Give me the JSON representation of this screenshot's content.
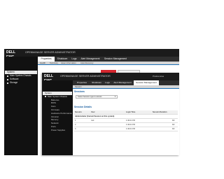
{
  "back_window": {
    "brand": "DELL EMC",
    "app_title": "OPENMANAGE SERVER ADMINISTRATOR",
    "host_info": "",
    "tree": [
      {
        "label": "System",
        "selected": true
      },
      {
        "label": "Main System Chassis",
        "selected": false
      },
      {
        "label": "Software",
        "selected": false
      },
      {
        "label": "Storage",
        "selected": false
      }
    ],
    "tabs": [
      {
        "label": "Properties",
        "active": true
      },
      {
        "label": "Shutdown",
        "active": false
      },
      {
        "label": "Logs",
        "active": false
      },
      {
        "label": "Alert Management",
        "active": false
      },
      {
        "label": "Session Management",
        "active": false
      }
    ],
    "subtabs": [
      "Health",
      "Summary",
      "Asset Information",
      "Auto Recovery"
    ],
    "alert_text": "",
    "action_button": ""
  },
  "front_window": {
    "brand": "DELL EMC",
    "app_title": "OPENMANAGE SERVER ADMINISTRATOR",
    "title_right": "Preferences",
    "host_info": "",
    "tree": [
      {
        "label": "System",
        "selected": true,
        "child": false
      },
      {
        "label": "Main System Chassis",
        "selected": false,
        "child": false
      },
      {
        "label": "Batteries",
        "selected": false,
        "child": true
      },
      {
        "label": "BIOS",
        "selected": false,
        "child": true
      },
      {
        "label": "Fans",
        "selected": false,
        "child": true
      },
      {
        "label": "Firmware",
        "selected": false,
        "child": true
      },
      {
        "label": "Hardware Performance",
        "selected": false,
        "child": true
      },
      {
        "label": "Intrusion",
        "selected": false,
        "child": true
      },
      {
        "label": "Memory",
        "selected": false,
        "child": true
      },
      {
        "label": "Network",
        "selected": false,
        "child": true
      },
      {
        "label": "Ports",
        "selected": false,
        "child": true
      },
      {
        "label": "Power Supplies",
        "selected": false,
        "child": true
      }
    ],
    "tabs": [
      {
        "label": "Properties",
        "active": false
      },
      {
        "label": "Shutdown",
        "active": false
      },
      {
        "label": "Logs",
        "active": false
      },
      {
        "label": "Alert Management",
        "active": false
      },
      {
        "label": "Session Management",
        "active": true
      }
    ],
    "subtabs": [
      "Session"
    ],
    "sessions": {
      "heading": "Sessions",
      "select_value": "Select Session type to access",
      "details_heading": "Session Details",
      "columns": [
        "Session",
        "User",
        "Login Time",
        "Session Duration"
      ],
      "group_label": "Administrator (Current Session on this system)",
      "rows": [
        {
          "session": "1",
          "user": "root",
          "login": "1:46:21 PM",
          "duration": "Kill"
        },
        {
          "session": "2",
          "user": "",
          "login": "1:46:21 PM",
          "duration": "Kill"
        },
        {
          "session": "3",
          "user": "",
          "login": "1:46:21 PM",
          "duration": "Kill"
        }
      ]
    }
  },
  "colors": {
    "titlebar": "#1b1b1b",
    "sidebar": "#111111",
    "tabbar": "#2e2e2e",
    "accent": "#1a5fa0",
    "alert": "#d5262e"
  }
}
